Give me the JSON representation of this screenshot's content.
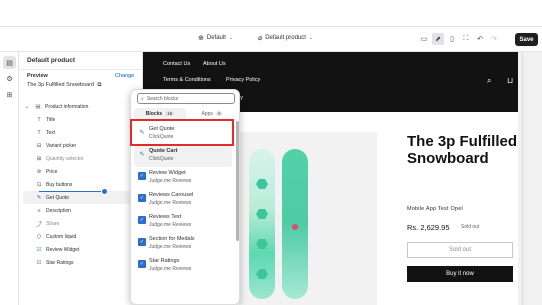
{
  "topbar": {
    "theme_select": "Default",
    "template_select": "Default product",
    "save_label": "Save"
  },
  "sidebar": {
    "title": "Default product",
    "preview_label": "Preview",
    "change_label": "Change",
    "preview_value": "The 3p Fulfilled Snowboard",
    "items": [
      {
        "label": "Product information",
        "icon": "section-icon"
      },
      {
        "label": "Title",
        "icon": "text-icon"
      },
      {
        "label": "Text",
        "icon": "text-icon"
      },
      {
        "label": "Variant picker",
        "icon": "variant-icon"
      },
      {
        "label": "Quantity selector",
        "icon": "quantity-icon"
      },
      {
        "label": "Price",
        "icon": "price-icon"
      },
      {
        "label": "Buy buttons",
        "icon": "buy-icon"
      },
      {
        "label": "Get Quote",
        "icon": "app-icon"
      },
      {
        "label": "Description",
        "icon": "text-icon"
      },
      {
        "label": "Share",
        "icon": "share-icon"
      },
      {
        "label": "Custom liquid",
        "icon": "code-icon"
      },
      {
        "label": "Review Widget",
        "icon": "app-icon"
      },
      {
        "label": "Star Ratings",
        "icon": "app-icon"
      }
    ]
  },
  "popover": {
    "search_placeholder": "Search blocks",
    "tab_blocks": "Blocks",
    "tab_blocks_count": "16",
    "tab_apps": "Apps",
    "tab_apps_count": "9",
    "items": [
      {
        "name": "Get Quote",
        "sub": "ClickQuote"
      },
      {
        "name": "Quote Cart",
        "sub": "ClickQuote"
      },
      {
        "name": "Review Widget",
        "sub": "Judge.me Reviews"
      },
      {
        "name": "Reviews Carousel",
        "sub": "Judge.me Reviews"
      },
      {
        "name": "Reviews Text",
        "sub": "Judge.me Reviews"
      },
      {
        "name": "Section for Medals",
        "sub": "Judge.me Reviews"
      },
      {
        "name": "Star Ratings",
        "sub": "Judge.me Reviews"
      }
    ]
  },
  "store": {
    "nav": [
      "Contact Us",
      "About Us",
      "Terms & Conditions",
      "Privacy Policy",
      "licy"
    ],
    "product_title": "The 3p Fulfilled Snowboard",
    "vendor": "Mobile App Test Opel",
    "price": "Rs. 2,629.95",
    "sold_badge": "Sold out",
    "sold_button": "Sold out",
    "buy_button": "Buy it now"
  },
  "colors": {
    "accent": "#2c6ecb",
    "highlight_border": "#e22b2b",
    "store_header": "#121212"
  }
}
